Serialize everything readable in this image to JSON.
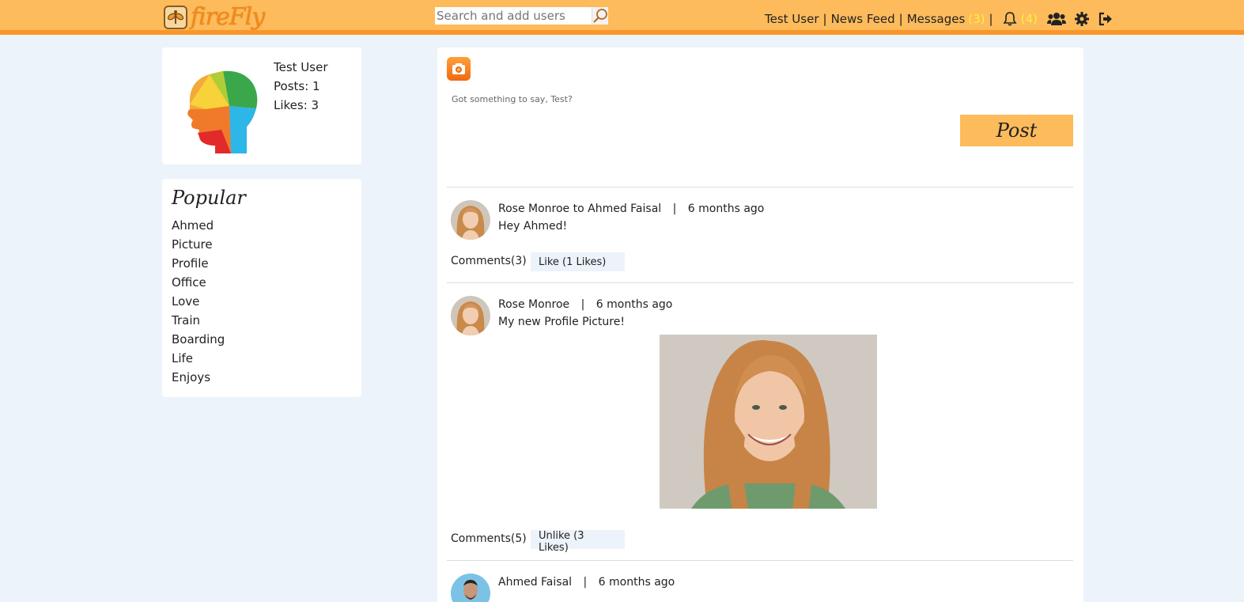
{
  "header": {
    "logo_text": "fireFly",
    "search_placeholder": "Search and add users",
    "nav": {
      "user": "Test User",
      "news_feed": "News Feed",
      "messages": "Messages",
      "messages_count": "(3)",
      "notifications_count": "(4)",
      "separator": "|"
    },
    "count_color": "#fff23a",
    "bar_color": "#fdbb5b"
  },
  "profile": {
    "name": "Test User",
    "posts": "Posts: 1",
    "likes": "Likes: 3"
  },
  "popular": {
    "title": "Popular",
    "items": [
      "Ahmed",
      "Picture",
      "Profile",
      "Office",
      "Love",
      "Train",
      "Boarding",
      "Life",
      "Enjoys"
    ]
  },
  "composer": {
    "prompt": "Got something to say, Test?",
    "post_label": "Post"
  },
  "feed": [
    {
      "author": "Rose Monroe to Ahmed Faisal",
      "time": "6 months ago",
      "text": "Hey Ahmed!",
      "comments": "Comments(3)",
      "like": "Like (1 Likes)"
    },
    {
      "author": "Rose Monroe",
      "time": "6 months ago",
      "text": "My new Profile Picture!",
      "comments": "Comments(5)",
      "like": "Unlike (3 Likes)"
    },
    {
      "author": "Ahmed Faisal",
      "time": "6 months ago"
    }
  ]
}
